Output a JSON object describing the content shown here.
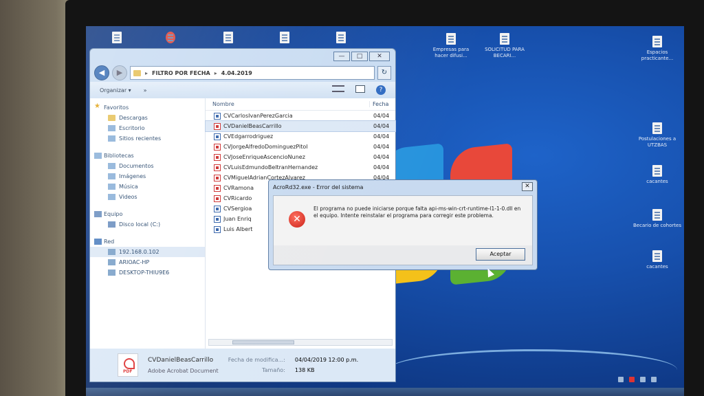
{
  "desktop": {
    "icons": [
      {
        "label": "Empresas para hacer difusi..."
      },
      {
        "label": "SOLICITUD PARA BECARI..."
      },
      {
        "label": "Espacios practicante..."
      },
      {
        "label": "Postulaciones a UTZBAS"
      },
      {
        "label": "cacantes"
      },
      {
        "label": "Becario de cohortes"
      },
      {
        "label": "cacantes"
      }
    ]
  },
  "explorer": {
    "window_buttons": {
      "minimize": "—",
      "maximize": "□",
      "close": "✕"
    },
    "address": {
      "back": "◀",
      "forward": "▶",
      "path": [
        "FILTRO POR FECHA",
        "4.04.2019"
      ],
      "separator": "▸",
      "refresh": "↻"
    },
    "toolbar": {
      "organize": "Organizar ▾",
      "more": "»",
      "help": "?"
    },
    "nav": {
      "favorites": {
        "label": "Favoritos",
        "items": [
          "Descargas",
          "Escritorio",
          "Sitios recientes"
        ]
      },
      "libraries": {
        "label": "Bibliotecas",
        "items": [
          "Documentos",
          "Imágenes",
          "Música",
          "Videos"
        ]
      },
      "computer": {
        "label": "Equipo",
        "items": [
          "Disco local (C:)"
        ]
      },
      "network": {
        "label": "Red",
        "items": [
          "192.168.0.102",
          "ARIOAC-HP",
          "DESKTOP-THIU9E6"
        ]
      }
    },
    "columns": {
      "name": "Nombre",
      "date": "Fecha"
    },
    "files": [
      {
        "name": "CVCarlosIvanPerezGarcia",
        "date": "04/04",
        "type": "doc"
      },
      {
        "name": "CVDanielBeasCarrillo",
        "date": "04/04",
        "type": "pdf"
      },
      {
        "name": "CVEdgarrodriguez",
        "date": "04/04",
        "type": "doc"
      },
      {
        "name": "CVJorgeAlfredoDominguezPitol",
        "date": "04/04",
        "type": "pdf"
      },
      {
        "name": "CVJoseEnriqueAscencioNunez",
        "date": "04/04",
        "type": "pdf"
      },
      {
        "name": "CVLuisEdmundoBeltranHernandez",
        "date": "04/04",
        "type": "pdf"
      },
      {
        "name": "CVMiguelAdrianCortezAlvarez",
        "date": "04/04",
        "type": "pdf"
      },
      {
        "name": "CVRamona",
        "date": "",
        "type": "pdf"
      },
      {
        "name": "CVRicardo",
        "date": "",
        "type": "pdf"
      },
      {
        "name": "CVSergioa",
        "date": "",
        "type": "doc"
      },
      {
        "name": "Juan Enriq",
        "date": "",
        "type": "doc"
      },
      {
        "name": "Luis Albert",
        "date": "",
        "type": "doc"
      }
    ],
    "details": {
      "file_name": "CVDanielBeasCarrillo",
      "file_type": "Adobe Acrobat Document",
      "modified_label": "Fecha de modifica...:",
      "modified_value": "04/04/2019 12:00 p.m.",
      "size_label": "Tamaño:",
      "size_value": "138 KB",
      "icon_text": "PDF"
    }
  },
  "dialog": {
    "title": "AcroRd32.exe - Error del sistema",
    "close": "✕",
    "icon_text": "✕",
    "message": "El programa no puede iniciarse porque falta api-ms-win-crt-runtime-l1-1-0.dll en el equipo. Intente reinstalar el programa para corregir este problema.",
    "ok_label": "Aceptar"
  }
}
